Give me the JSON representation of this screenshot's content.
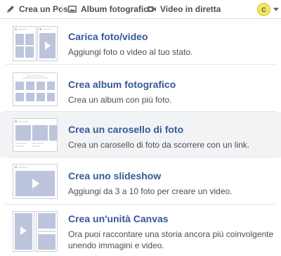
{
  "tabs": [
    {
      "label": "Crea un Post",
      "icon": "pencil-icon"
    },
    {
      "label": "Album fotografico",
      "icon": "photo-album-icon"
    },
    {
      "label": "Video in diretta",
      "icon": "video-camera-icon"
    }
  ],
  "avatar": {
    "initial": "C"
  },
  "options": [
    {
      "title": "Carica foto/video",
      "desc": "Aggiungi foto o video al tuo stato."
    },
    {
      "title": "Crea album fotografico",
      "desc": "Crea un album con più foto."
    },
    {
      "title": "Crea un carosello di foto",
      "desc": "Crea un carosello di foto da scorrere con un link."
    },
    {
      "title": "Crea uno slideshow",
      "desc": "Aggiungi da 3 a 10 foto per creare un video."
    },
    {
      "title": "Crea un'unità Canvas",
      "desc": "Ora puoi raccontare una storia ancora più coinvolgente unendo immagini e video."
    }
  ],
  "colors": {
    "accent": "#365899",
    "placeholder": "#bdc5dc",
    "highlight_row": "#f2f3f5"
  }
}
